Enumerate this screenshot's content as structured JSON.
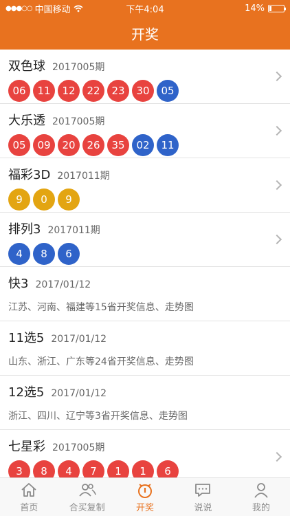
{
  "status_bar": {
    "signal": "●●●○○",
    "carrier": "中国移动",
    "wifi": "wifi-icon",
    "time": "下午4:04",
    "battery_text": "14%",
    "battery_level": 0.14
  },
  "header": {
    "title": "开奖"
  },
  "colors": {
    "accent": "#e8721f",
    "red_ball": "#e8433f",
    "blue_ball": "#2f63c9",
    "yellow_ball": "#e3a512"
  },
  "lotteries": [
    {
      "title": "双色球",
      "period": "2017005期",
      "balls": [
        {
          "n": "06",
          "c": "red"
        },
        {
          "n": "11",
          "c": "red"
        },
        {
          "n": "12",
          "c": "red"
        },
        {
          "n": "22",
          "c": "red"
        },
        {
          "n": "23",
          "c": "red"
        },
        {
          "n": "30",
          "c": "red"
        },
        {
          "n": "05",
          "c": "blue"
        }
      ]
    },
    {
      "title": "大乐透",
      "period": "2017005期",
      "balls": [
        {
          "n": "05",
          "c": "red"
        },
        {
          "n": "09",
          "c": "red"
        },
        {
          "n": "20",
          "c": "red"
        },
        {
          "n": "26",
          "c": "red"
        },
        {
          "n": "35",
          "c": "red"
        },
        {
          "n": "02",
          "c": "blue"
        },
        {
          "n": "11",
          "c": "blue"
        }
      ]
    },
    {
      "title": "福彩3D",
      "period": "2017011期",
      "balls": [
        {
          "n": "9",
          "c": "yellow"
        },
        {
          "n": "0",
          "c": "yellow"
        },
        {
          "n": "9",
          "c": "yellow"
        }
      ]
    },
    {
      "title": "排列3",
      "period": "2017011期",
      "balls": [
        {
          "n": "4",
          "c": "blue"
        },
        {
          "n": "8",
          "c": "blue"
        },
        {
          "n": "6",
          "c": "blue"
        }
      ]
    },
    {
      "title": "快3",
      "period": "2017/01/12",
      "desc": "江苏、河南、福建等15省开奖信息、走势图"
    },
    {
      "title": "11选5",
      "period": "2017/01/12",
      "desc": "山东、浙江、广东等24省开奖信息、走势图"
    },
    {
      "title": "12选5",
      "period": "2017/01/12",
      "desc": "浙江、四川、辽宁等3省开奖信息、走势图"
    },
    {
      "title": "七星彩",
      "period": "2017005期",
      "balls": [
        {
          "n": "3",
          "c": "red"
        },
        {
          "n": "8",
          "c": "red"
        },
        {
          "n": "4",
          "c": "red"
        },
        {
          "n": "7",
          "c": "red"
        },
        {
          "n": "1",
          "c": "red"
        },
        {
          "n": "1",
          "c": "red"
        },
        {
          "n": "6",
          "c": "red"
        }
      ]
    }
  ],
  "tabbar": [
    {
      "label": "首页",
      "icon": "home-icon",
      "active": false
    },
    {
      "label": "合买复制",
      "icon": "users-icon",
      "active": false
    },
    {
      "label": "开奖",
      "icon": "lottery-icon",
      "active": true
    },
    {
      "label": "说说",
      "icon": "chat-icon",
      "active": false
    },
    {
      "label": "我的",
      "icon": "person-icon",
      "active": false
    }
  ]
}
